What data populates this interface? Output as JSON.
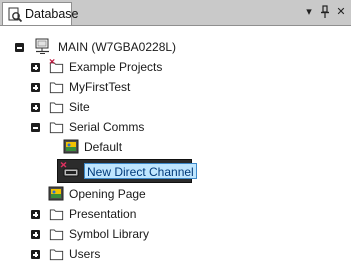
{
  "window": {
    "tab_label": "Database",
    "tab_icon": "database-search-icon",
    "controls": [
      "dropdown-icon",
      "pin-icon",
      "close-icon"
    ]
  },
  "tree": {
    "root": {
      "label": "MAIN (W7GBA0228L)",
      "icon": "computer-icon",
      "expanded": true
    },
    "items": [
      {
        "label": "Example Projects",
        "icon": "folder-excluded-icon",
        "expanded": false
      },
      {
        "label": "MyFirstTest",
        "icon": "folder-icon",
        "expanded": false
      },
      {
        "label": "Site",
        "icon": "folder-icon",
        "expanded": false
      },
      {
        "label": "Serial Comms",
        "icon": "folder-icon",
        "expanded": true
      },
      {
        "label": "Default",
        "icon": "mimic-page-icon"
      },
      {
        "label": "New Direct Channel",
        "icon": "direct-channel-icon",
        "editing": true
      },
      {
        "label": "Opening Page",
        "icon": "mimic-page-icon"
      },
      {
        "label": "Presentation",
        "icon": "folder-icon",
        "expanded": false
      },
      {
        "label": "Symbol Library",
        "icon": "folder-icon",
        "expanded": false
      },
      {
        "label": "Users",
        "icon": "folder-icon",
        "expanded": false
      }
    ]
  },
  "colors": {
    "selection_highlight": "#bfe6ff",
    "selection_box": "#2b2b2b"
  }
}
